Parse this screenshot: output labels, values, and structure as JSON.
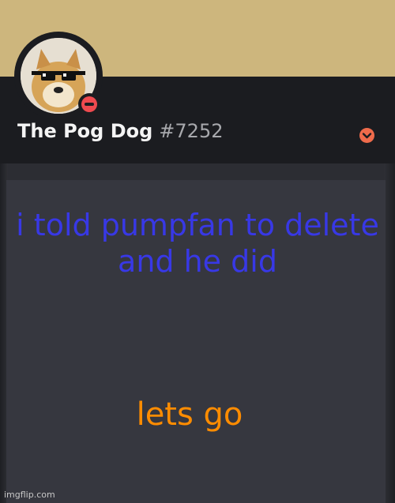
{
  "profile": {
    "username": "The Pog Dog",
    "discriminator": "#7252",
    "status": "do-not-disturb",
    "avatar_icon": "doge-sunglasses-avatar",
    "expand_icon": "chevron-down-icon"
  },
  "meme": {
    "line1": "i told pumpfan to delete and he did",
    "line2": "lets go",
    "line1_color": "#3838e6",
    "line2_color": "#ff8c00"
  },
  "watermark": "imgflip.com",
  "colors": {
    "banner": "#cdb67d",
    "header": "#1b1c20",
    "panel": "#36373f",
    "status_dnd": "#ef4a4f",
    "accent": "#ef6b4b"
  }
}
